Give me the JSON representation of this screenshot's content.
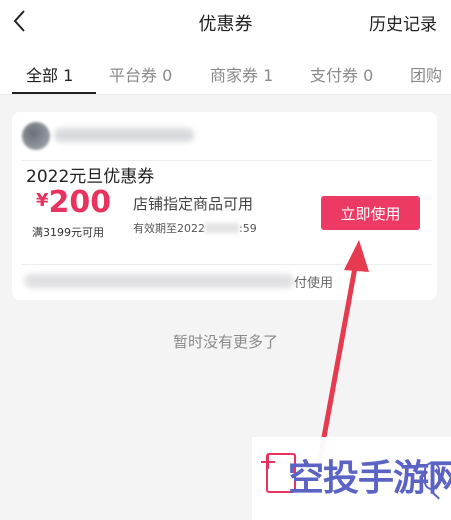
{
  "header": {
    "title": "优惠券",
    "history_label": "历史记录",
    "back_icon": "chevron-left-icon"
  },
  "tabs": [
    {
      "label": "全部 1",
      "active": true
    },
    {
      "label": "平台券 0",
      "active": false
    },
    {
      "label": "商家券 1",
      "active": false
    },
    {
      "label": "支付券 0",
      "active": false
    },
    {
      "label": "团购",
      "active": false
    }
  ],
  "coupon": {
    "title": "2022元旦优惠券",
    "currency": "¥",
    "amount": "200",
    "threshold": "满3199元可用",
    "description": "店铺指定商品可用",
    "validity_prefix": "有效期至2022",
    "validity_suffix": ":59",
    "use_button": "立即使用",
    "scope_tail": "付使用"
  },
  "footer": {
    "no_more": "暂时没有更多了"
  },
  "watermark": {
    "text": "空投手游网"
  },
  "colors": {
    "accent": "#ec3a64",
    "amount": "#e8335f",
    "annotation_arrow": "#e53a4f",
    "watermark_text": "#5b63c4"
  }
}
